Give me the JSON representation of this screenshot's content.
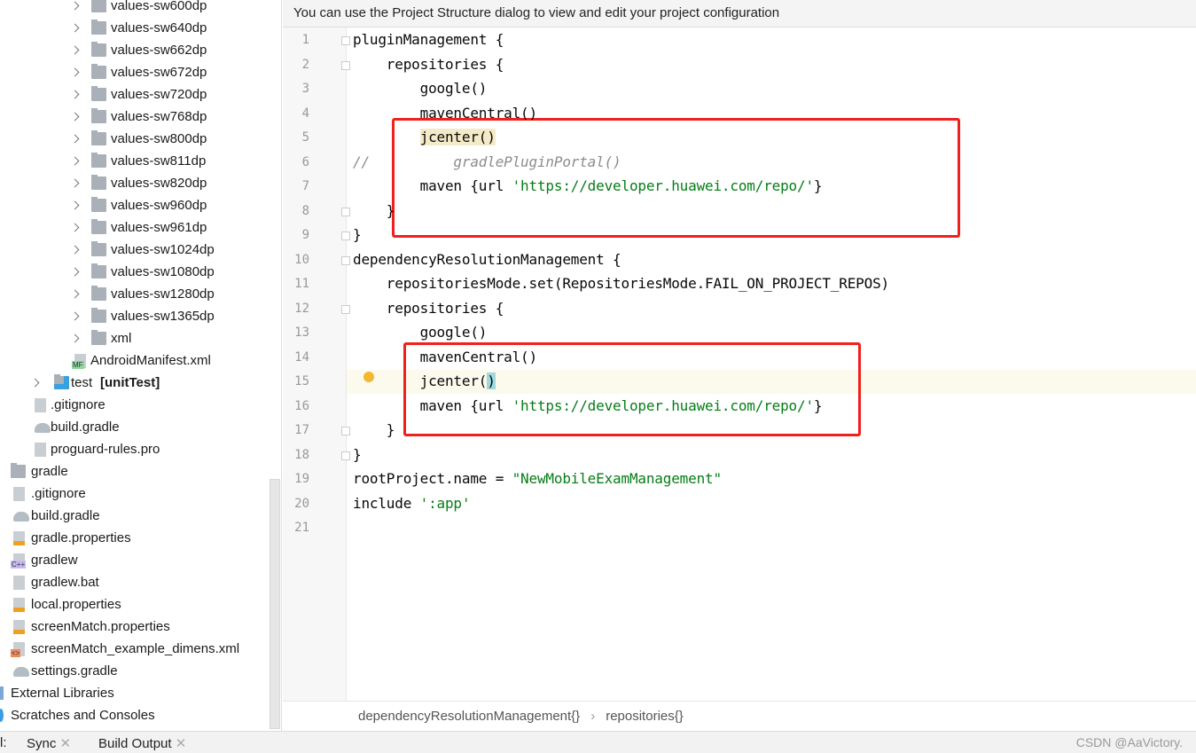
{
  "sidebar": {
    "items": [
      {
        "label": "values-sw600dp",
        "level": 3,
        "type": "folder",
        "chevron": true
      },
      {
        "label": "values-sw640dp",
        "level": 3,
        "type": "folder",
        "chevron": true
      },
      {
        "label": "values-sw662dp",
        "level": 3,
        "type": "folder",
        "chevron": true
      },
      {
        "label": "values-sw672dp",
        "level": 3,
        "type": "folder",
        "chevron": true
      },
      {
        "label": "values-sw720dp",
        "level": 3,
        "type": "folder",
        "chevron": true
      },
      {
        "label": "values-sw768dp",
        "level": 3,
        "type": "folder",
        "chevron": true
      },
      {
        "label": "values-sw800dp",
        "level": 3,
        "type": "folder",
        "chevron": true
      },
      {
        "label": "values-sw811dp",
        "level": 3,
        "type": "folder",
        "chevron": true
      },
      {
        "label": "values-sw820dp",
        "level": 3,
        "type": "folder",
        "chevron": true
      },
      {
        "label": "values-sw960dp",
        "level": 3,
        "type": "folder",
        "chevron": true
      },
      {
        "label": "values-sw961dp",
        "level": 3,
        "type": "folder",
        "chevron": true
      },
      {
        "label": "values-sw1024dp",
        "level": 3,
        "type": "folder",
        "chevron": true
      },
      {
        "label": "values-sw1080dp",
        "level": 3,
        "type": "folder",
        "chevron": true
      },
      {
        "label": "values-sw1280dp",
        "level": 3,
        "type": "folder",
        "chevron": true
      },
      {
        "label": "values-sw1365dp",
        "level": 3,
        "type": "folder",
        "chevron": true
      },
      {
        "label": "xml",
        "level": 3,
        "type": "folder",
        "chevron": true
      },
      {
        "label": "AndroidManifest.xml",
        "level": 2,
        "type": "manifest",
        "badge": "MF"
      },
      {
        "label": "test",
        "suffix": "[unitTest]",
        "level": 1,
        "type": "test-folder",
        "chevron": true
      },
      {
        "label": ".gitignore",
        "level": 0.6,
        "type": "gitignore"
      },
      {
        "label": "build.gradle",
        "level": 0.6,
        "type": "gradle"
      },
      {
        "label": "proguard-rules.pro",
        "level": 0.6,
        "type": "text"
      },
      {
        "label": "gradle",
        "level": 0,
        "type": "folder"
      },
      {
        "label": ".gitignore",
        "level": 0,
        "type": "gitignore"
      },
      {
        "label": "build.gradle",
        "level": 0,
        "type": "gradle"
      },
      {
        "label": "gradle.properties",
        "level": 0,
        "type": "properties"
      },
      {
        "label": "gradlew",
        "level": 0,
        "type": "script",
        "badge": "C++"
      },
      {
        "label": "gradlew.bat",
        "level": 0,
        "type": "text"
      },
      {
        "label": "local.properties",
        "level": 0,
        "type": "properties"
      },
      {
        "label": "screenMatch.properties",
        "level": 0,
        "type": "properties"
      },
      {
        "label": "screenMatch_example_dimens.xml",
        "level": 0,
        "type": "xml",
        "badge": "<>"
      },
      {
        "label": "settings.gradle",
        "level": 0,
        "type": "gradle"
      },
      {
        "label": "External Libraries",
        "level": -1,
        "type": "library"
      },
      {
        "label": "Scratches and Consoles",
        "level": -1,
        "type": "scratches"
      }
    ]
  },
  "banner": "You can use the Project Structure dialog to view and edit your project configuration",
  "editor": {
    "current_line": 15,
    "lines": [
      [
        {
          "t": "pluginManagement {"
        }
      ],
      [
        {
          "t": "    repositories {"
        }
      ],
      [
        {
          "t": "        google()"
        }
      ],
      [
        {
          "t": "        mavenCentral()"
        }
      ],
      [
        {
          "t": "        "
        },
        {
          "t": "jcenter()",
          "c": "hl"
        }
      ],
      [
        {
          "t": "//",
          "c": "cm"
        },
        {
          "t": "          gradlePluginPortal()",
          "c": "cm"
        }
      ],
      [
        {
          "t": "        maven {url "
        },
        {
          "t": "'https://developer.huawei.com/repo/'",
          "c": "str"
        },
        {
          "t": "}"
        }
      ],
      [
        {
          "t": "    }"
        }
      ],
      [
        {
          "t": "}"
        }
      ],
      [
        {
          "t": "dependencyResolutionManagement {"
        }
      ],
      [
        {
          "t": "    repositoriesMode.set(RepositoriesMode.FAIL_ON_PROJECT_REPOS)"
        }
      ],
      [
        {
          "t": "    repositories {"
        }
      ],
      [
        {
          "t": "        google()"
        }
      ],
      [
        {
          "t": "        mavenCentral()"
        }
      ],
      [
        {
          "t": "        jcenter("
        },
        {
          "t": ")",
          "c": "br"
        }
      ],
      [
        {
          "t": "        maven {url "
        },
        {
          "t": "'https://developer.huawei.com/repo/'",
          "c": "str"
        },
        {
          "t": "}"
        }
      ],
      [
        {
          "t": "    }"
        }
      ],
      [
        {
          "t": "}"
        }
      ],
      [
        {
          "t": "rootProject.name = "
        },
        {
          "t": "\"NewMobileExamManagement\"",
          "c": "str"
        }
      ],
      [
        {
          "t": "include "
        },
        {
          "t": "':app'",
          "c": "str"
        }
      ],
      []
    ]
  },
  "breadcrumb": [
    "dependencyResolutionManagement{}",
    "repositories{}"
  ],
  "bottom_bar": {
    "prefix": "l:",
    "tabs": [
      "Sync",
      "Build Output"
    ]
  },
  "watermark": "CSDN @AaVictory.",
  "colors": {
    "string": "#067d17",
    "comment": "#8c8c8c",
    "annotation_box": "#f0201c",
    "current_line": "#fcfaed"
  }
}
